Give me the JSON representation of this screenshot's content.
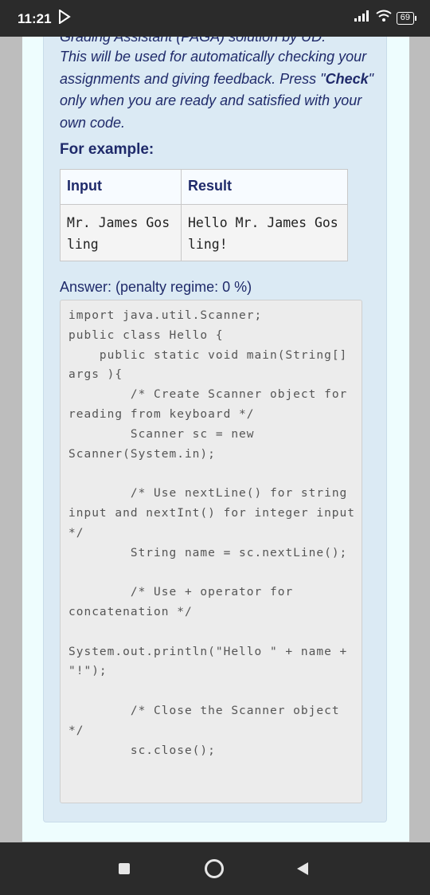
{
  "status_bar": {
    "time": "11:21",
    "battery": "69"
  },
  "question": {
    "cutoff_line": "Grading Assistant (PAGA) solution by UD.",
    "intro": {
      "before": "This will be used for automatically checking your assignments and giving feedback. Press \"",
      "bold": "Check",
      "after": "\" only when you are ready and satisfied with your own code."
    },
    "example_label": "For example:",
    "table": {
      "headers": [
        "Input",
        "Result"
      ],
      "row": [
        "Mr. James Gosling",
        "Hello Mr. James Gosling!"
      ]
    },
    "answer_label": "Answer:  (penalty regime: 0 %)",
    "code": "import java.util.Scanner;\npublic class Hello {\n    public static void main(String[] args ){\n        /* Create Scanner object for reading from keyboard */\n        Scanner sc = new Scanner(System.in);\n\n        /* Use nextLine() for string input and nextInt() for integer input */\n        String name = sc.nextLine();\n\n        /* Use + operator for concatenation */\n\nSystem.out.println(\"Hello \" + name + \"!\");\n\n        /* Close the Scanner object */\n        sc.close();"
  },
  "icons": {
    "nav_recents": "square-icon",
    "nav_home": "circle-icon",
    "nav_back": "back-triangle-icon"
  }
}
